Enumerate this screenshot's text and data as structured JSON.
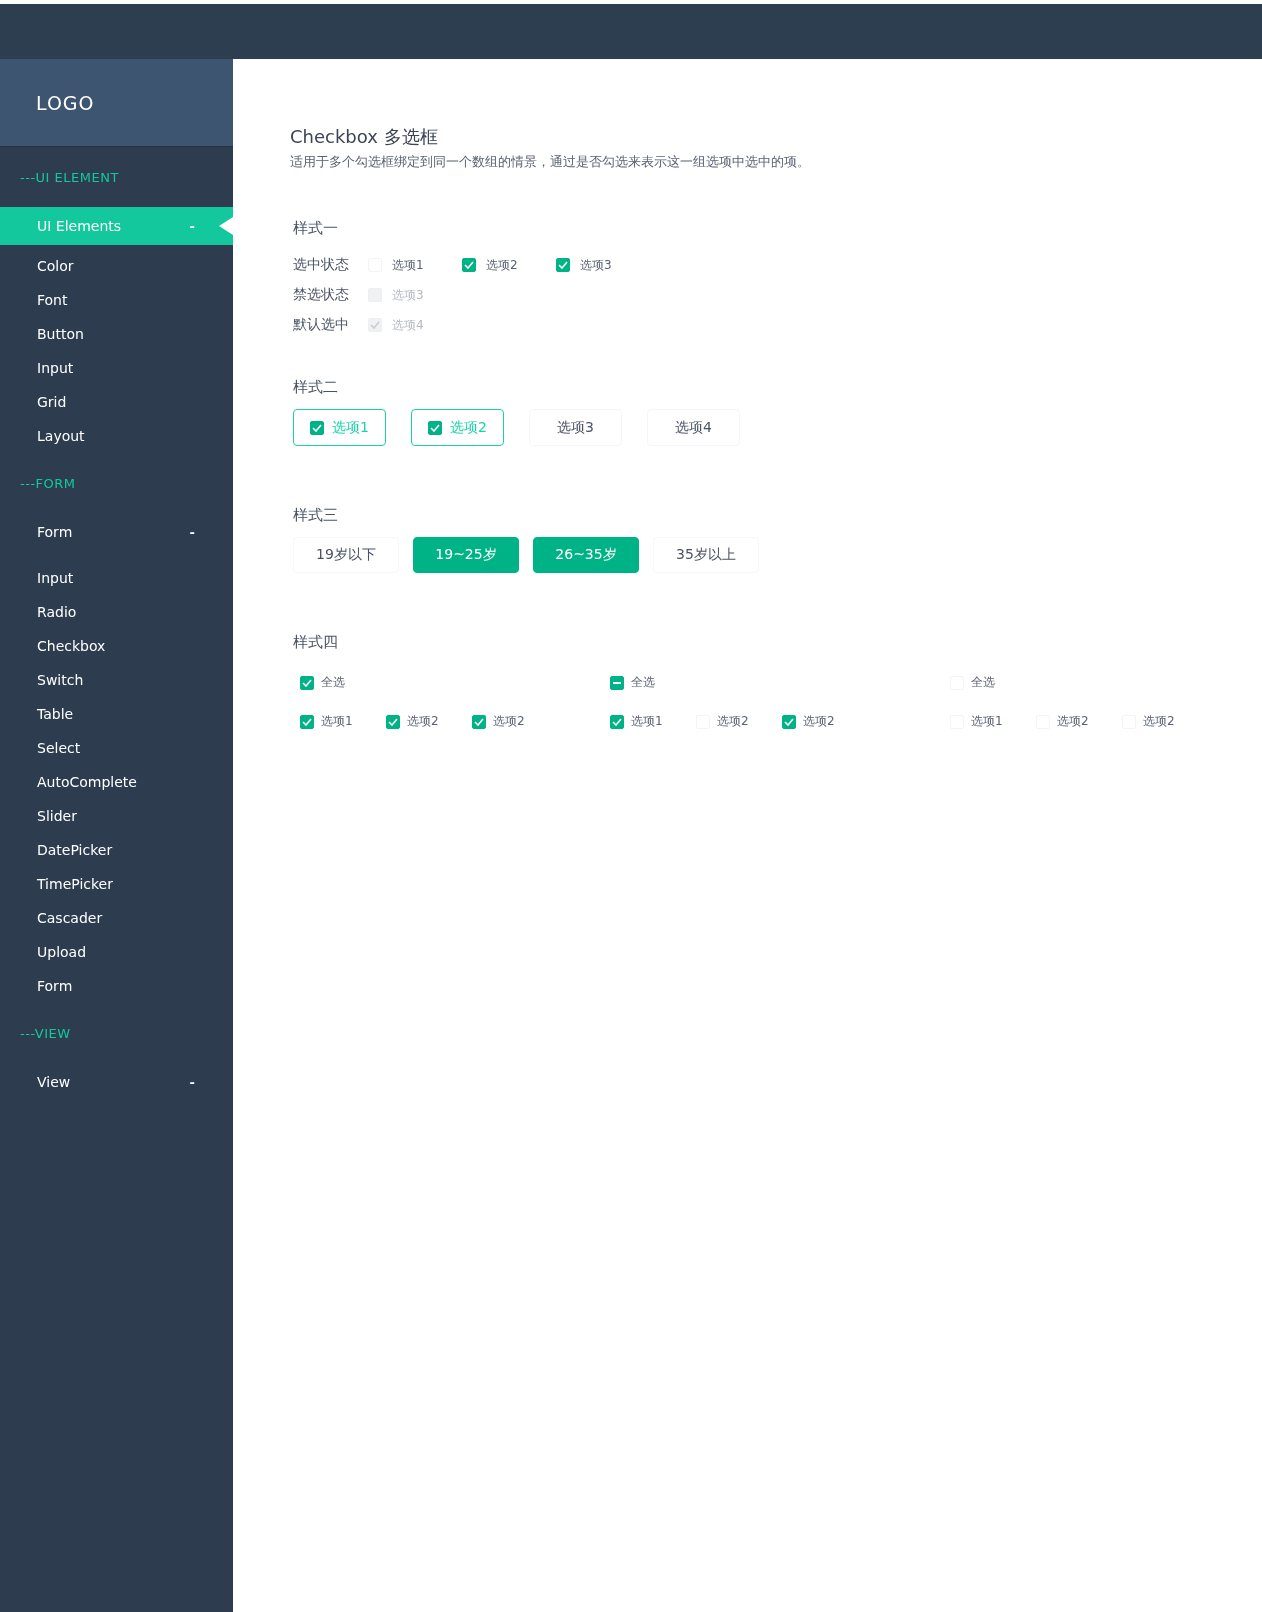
{
  "sidebar": {
    "logo": "LOGO",
    "sections": [
      {
        "header": "---UI ELEMENT",
        "group": {
          "label": "UI Elements",
          "toggle": "-",
          "selected": true
        },
        "items": [
          "Color",
          "Font",
          "Button",
          "Input",
          "Grid",
          "Layout"
        ]
      },
      {
        "header": "---FORM",
        "group": {
          "label": "Form",
          "toggle": "-",
          "selected": false
        },
        "items": [
          "Input",
          "Radio",
          "Checkbox",
          "Switch",
          "Table",
          "Select",
          "AutoComplete",
          "Slider",
          "DatePicker",
          "TimePicker",
          "Cascader",
          "Upload",
          "Form"
        ]
      },
      {
        "header": "---VIEW",
        "group": {
          "label": "View",
          "toggle": "-",
          "selected": false
        }
      }
    ]
  },
  "page": {
    "title": "Checkbox 多选框",
    "description": "适用于多个勾选框绑定到同一个数组的情景，通过是否勾选来表示这一组选项中选中的项。"
  },
  "style_one": {
    "heading": "样式一",
    "rows": [
      {
        "label": "选中状态",
        "options": [
          {
            "label": "选项1",
            "checked": false,
            "disabled": false
          },
          {
            "label": "选项2",
            "checked": true,
            "disabled": false
          },
          {
            "label": "选项3",
            "checked": true,
            "disabled": false
          }
        ]
      },
      {
        "label": "禁选状态",
        "options": [
          {
            "label": "选项3",
            "checked": false,
            "disabled": true
          }
        ]
      },
      {
        "label": "默认选中",
        "options": [
          {
            "label": "选项4",
            "checked": true,
            "disabled": true
          }
        ]
      }
    ]
  },
  "style_two": {
    "heading": "样式二",
    "options": [
      {
        "label": "选项1",
        "checked": true
      },
      {
        "label": "选项2",
        "checked": true
      },
      {
        "label": "选项3",
        "checked": false
      },
      {
        "label": "选项4",
        "checked": false
      }
    ]
  },
  "style_three": {
    "heading": "样式三",
    "options": [
      {
        "label": "19岁以下",
        "selected": false
      },
      {
        "label": "19~25岁",
        "selected": true
      },
      {
        "label": "26~35岁",
        "selected": true
      },
      {
        "label": "35岁以上",
        "selected": false
      }
    ]
  },
  "style_four": {
    "heading": "样式四",
    "groups": [
      {
        "all": {
          "label": "全选",
          "checked": true
        },
        "options": [
          {
            "label": "选项1",
            "checked": true
          },
          {
            "label": "选项2",
            "checked": true
          },
          {
            "label": "选项2",
            "checked": true
          }
        ]
      },
      {
        "all": {
          "label": "全选",
          "indeterminate": true
        },
        "options": [
          {
            "label": "选项1",
            "checked": true
          },
          {
            "label": "选项2",
            "checked": false
          },
          {
            "label": "选项2",
            "checked": true
          }
        ]
      },
      {
        "all": {
          "label": "全选",
          "checked": false,
          "indeterminate": false
        },
        "options": [
          {
            "label": "选项1",
            "checked": false
          },
          {
            "label": "选项2",
            "checked": false
          },
          {
            "label": "选项2",
            "checked": false
          }
        ]
      }
    ]
  }
}
